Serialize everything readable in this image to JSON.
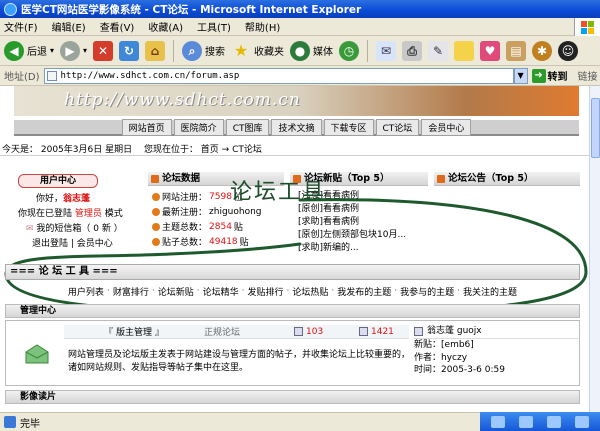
{
  "window": {
    "title": "医学CT网站医学影像系统 - CT论坛 - Microsoft Internet Explorer"
  },
  "menu": [
    "文件(F)",
    "编辑(E)",
    "查看(V)",
    "收藏(A)",
    "工具(T)",
    "帮助(H)"
  ],
  "toolbar": {
    "back": "后退",
    "search": "搜索",
    "favorites": "收藏夹",
    "media": "媒体"
  },
  "address": {
    "label": "地址(D)",
    "url": "http://www.sdhct.com.cn/forum.asp",
    "go": "转到",
    "links": "链接"
  },
  "page": {
    "banner_text": "http://www.sdhct.com.cn",
    "nav": [
      "网站首页",
      "医院简介",
      "CT图库",
      "技术文摘",
      "下载专区",
      "CT论坛",
      "会员中心"
    ],
    "location": "今天是： 2005年3月6日 星期日　 您现在位于： 首页 → CT论坛",
    "user_center": {
      "title": "用户中心",
      "greeting_prefix": "你好，",
      "username": "翁志蓬",
      "role_prefix": "你现在已登陆 ",
      "role": "管理员",
      "role_suffix": " 模式",
      "messages": "我的短信箱（ 0 新 ）",
      "logout": "退出登陆 | 会员中心"
    },
    "stats": {
      "title": "论坛数据",
      "rows": [
        {
          "label": "网站注册：",
          "value": "7598",
          "unit": "位"
        },
        {
          "label": "最新注册：",
          "value": "zhiguohong",
          "unit": ""
        },
        {
          "label": "主题总数：",
          "value": "2854",
          "unit": "贴"
        },
        {
          "label": "贴子总数：",
          "value": "49418",
          "unit": "贴"
        }
      ]
    },
    "new_posts": {
      "title": "论坛新贴（Top 5）",
      "items": [
        "[注意]看看病例",
        "[原创]看看病例",
        "[求助]看看病例",
        "[原创]左侧颈部包块10月...",
        "[求助]新编的..."
      ]
    },
    "announce": {
      "title": "论坛公告（Top 5）"
    },
    "annotation": "论坛工具",
    "tools_title": "=== 论 坛 工 具 ===",
    "tools": [
      "用户列表",
      "财富排行",
      "论坛新贴",
      "论坛精华",
      "发贴排行",
      "论坛热贴",
      "我发布的主题",
      "我参与的主题",
      "我关注的主题"
    ],
    "admin": {
      "head": "管理中心",
      "forum_name": "『 版主管理 』",
      "forum_type": "正规论坛",
      "topics": "103",
      "posts": "1421",
      "moderator": "翁志蓬 guojx",
      "desc": "网站管理员及论坛版主发表于网站建设与管理方面的帖子，并收集论坛上比较重要的，诸如网站规则、发贴指导等帖子集中在这里。",
      "latest_label": "新贴：",
      "latest": "[emb6]",
      "author_label": "作者：",
      "author": "hyczy",
      "time_label": "时间：",
      "time": "2005-3-6 0:59"
    },
    "image_section": "影像读片"
  },
  "status": {
    "text": "完毕"
  }
}
